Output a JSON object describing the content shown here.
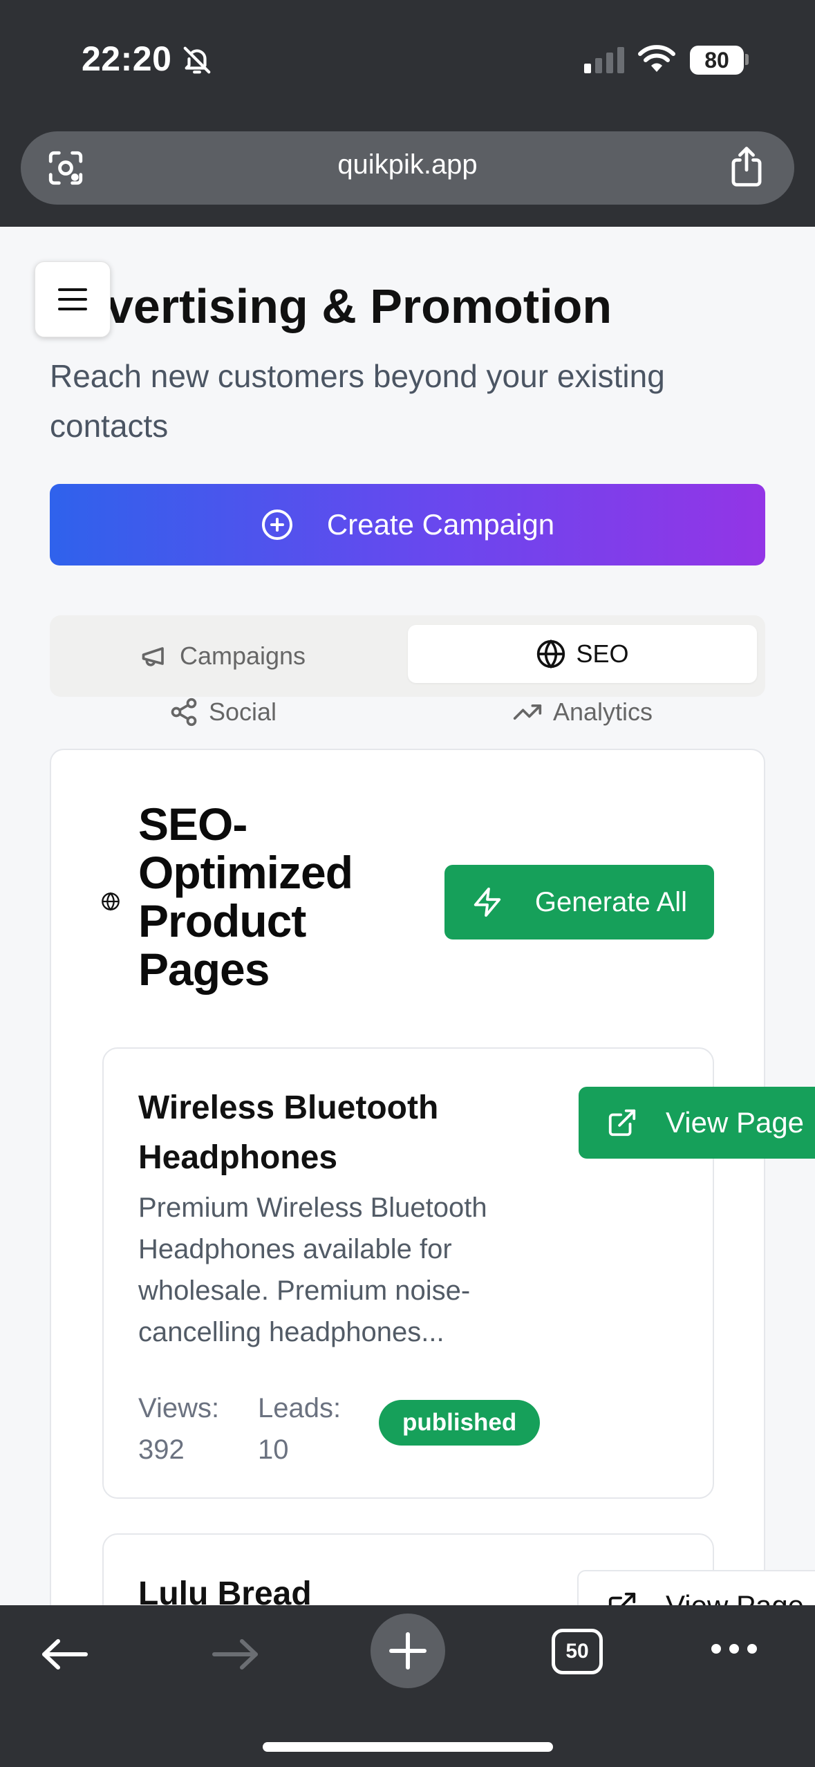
{
  "status_bar": {
    "time": "22:20",
    "battery": "80"
  },
  "browser": {
    "url": "quikpik.app",
    "tab_count": "50"
  },
  "page": {
    "title": "vertising & Promotion",
    "subtitle": "Reach new customers beyond your existing contacts",
    "create_button": "Create Campaign",
    "tabs": {
      "campaigns": "Campaigns",
      "seo": "SEO",
      "social": "Social",
      "analytics": "Analytics",
      "active": "seo"
    }
  },
  "seo_section": {
    "heading": "SEO-Optimized Product Pages",
    "generate_button": "Generate All",
    "products": [
      {
        "name": "Wireless Bluetooth Headphones",
        "description": "Premium Wireless Bluetooth Headphones available for wholesale. Premium noise-cancelling headphones...",
        "views_label": "Views:",
        "views": "392",
        "leads_label": "Leads:",
        "leads": "10",
        "status": "published",
        "view_button": "View Page"
      },
      {
        "name": "Lulu Bread",
        "view_button": "View Page"
      }
    ]
  },
  "colors": {
    "accent_green": "#16a05a",
    "gradient_start": "#2f62ec",
    "gradient_end": "#9335e6",
    "chrome": "#2f3135"
  }
}
